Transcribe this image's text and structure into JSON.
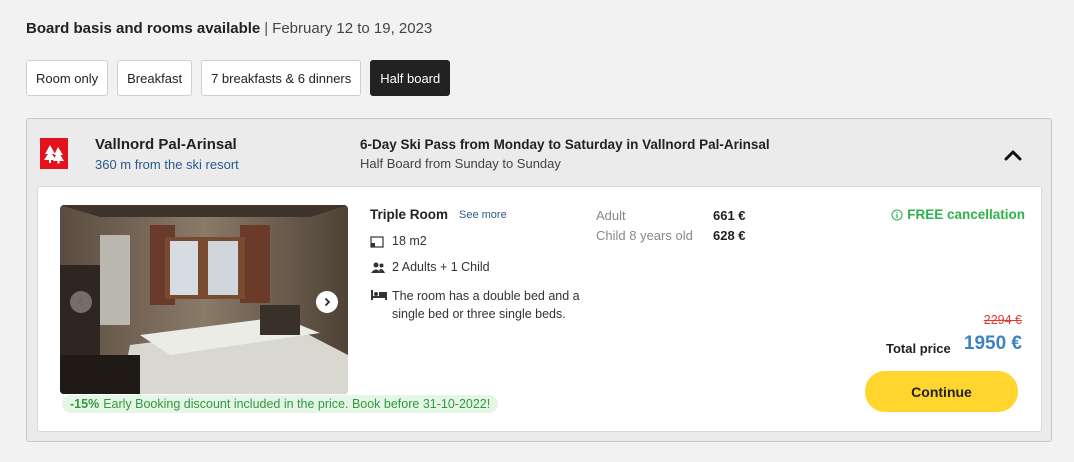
{
  "header": {
    "title": "Board basis and rooms available",
    "separator": "|",
    "dates": "February 12 to 19, 2023"
  },
  "board_filters": [
    {
      "label": "Room only",
      "selected": false
    },
    {
      "label": "Breakfast",
      "selected": false
    },
    {
      "label": "7 breakfasts & 6 dinners",
      "selected": false
    },
    {
      "label": "Half board",
      "selected": true
    }
  ],
  "resort": {
    "name": "Vallnord Pal-Arinsal",
    "distance": "360 m from the ski resort",
    "logo_color": "#e3131b"
  },
  "pass": {
    "title": "6-Day Ski Pass from Monday to Saturday in Vallnord Pal-Arinsal",
    "subtitle": "Half Board from Sunday to Sunday"
  },
  "room": {
    "name": "Triple Room",
    "see_more": "See more",
    "size": "18 m2",
    "occupancy": "2 Adults + 1 Child",
    "beds": "The room has a double bed and a single bed or three single beds.",
    "icons": [
      "room-size-icon",
      "people-icon",
      "bed-icon"
    ]
  },
  "discount": {
    "percent": "-15%",
    "text": "Early Booking discount included in the price. Book before 31-10-2022!"
  },
  "prices": {
    "rows": [
      {
        "label": "Adult",
        "value": "661 €"
      },
      {
        "label": "Child 8 years old",
        "value": "628 €"
      }
    ],
    "cancellation": "FREE cancellation",
    "old_price": "2294 €",
    "total_label": "Total price",
    "total_value": "1950 €"
  },
  "actions": {
    "continue_label": "Continue"
  },
  "colors": {
    "accent_blue": "#3d82c4",
    "button_yellow": "#ffd52e",
    "green": "#2eb24a",
    "strike_red": "#e23b2e"
  }
}
